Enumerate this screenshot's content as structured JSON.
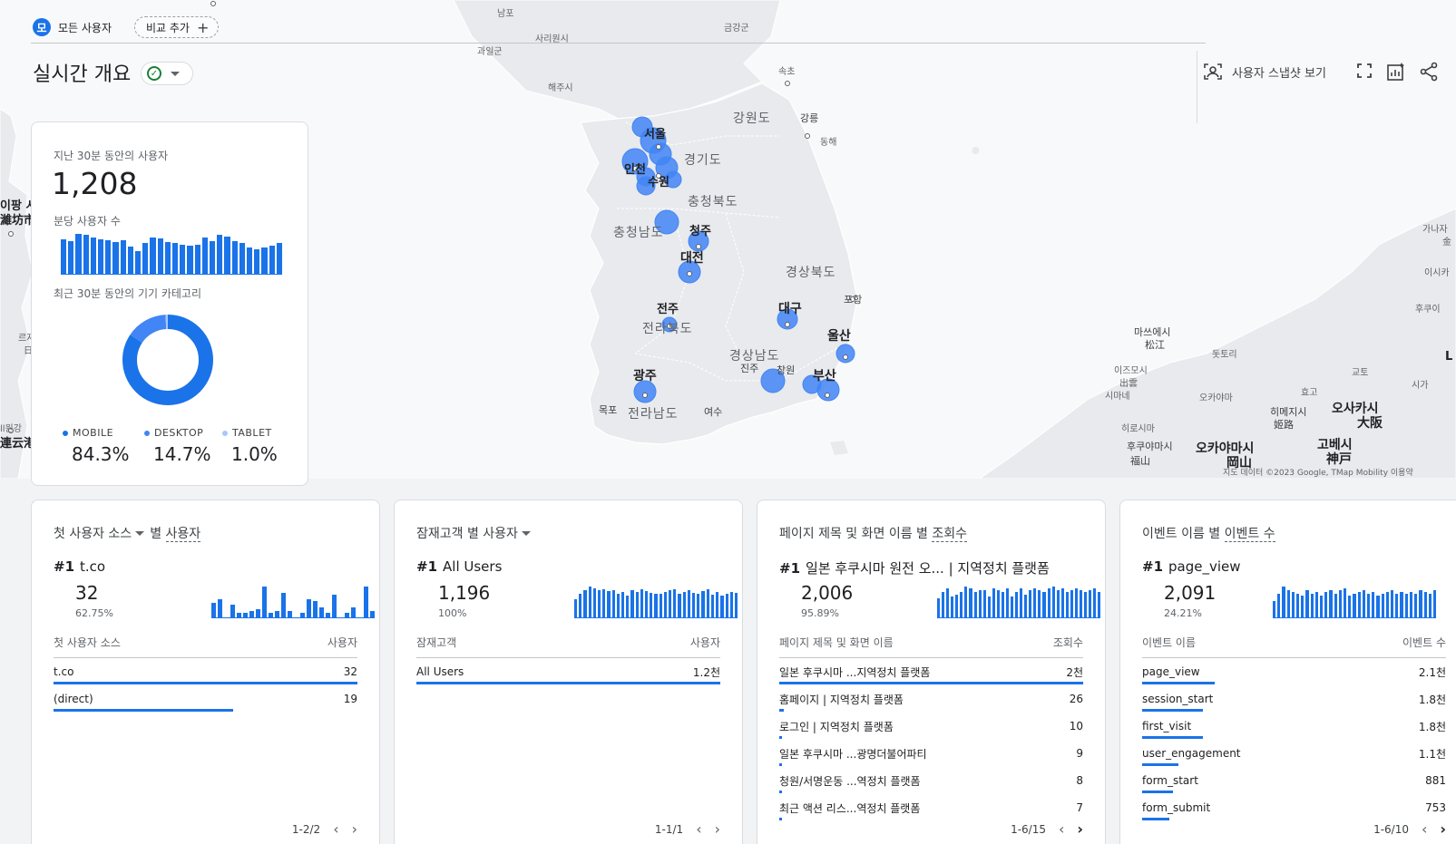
{
  "header": {
    "chip_all_avatar": "모",
    "chip_all_label": "모든 사용자",
    "chip_add_label": "비교 추가",
    "page_title": "실시간 개요",
    "snapshot_label": "사용자 스냅샷 보기"
  },
  "map": {
    "labels": [
      {
        "text": "남포",
        "cls": "tiny"
      },
      {
        "text": "금강군",
        "cls": "tiny"
      },
      {
        "text": "사리원시",
        "cls": "tiny"
      },
      {
        "text": "과일군",
        "cls": "tiny"
      },
      {
        "text": "속초",
        "cls": "tiny"
      },
      {
        "text": "해주시",
        "cls": "tiny"
      },
      {
        "text": "강원도",
        "cls": "prov"
      },
      {
        "text": "강릉",
        "cls": ""
      },
      {
        "text": "동해",
        "cls": "tiny"
      },
      {
        "text": "서울",
        "cls": "city"
      },
      {
        "text": "인천",
        "cls": "city"
      },
      {
        "text": "수원",
        "cls": "city"
      },
      {
        "text": "경기도",
        "cls": "prov"
      },
      {
        "text": "충청북도",
        "cls": "prov"
      },
      {
        "text": "충청남도",
        "cls": "prov"
      },
      {
        "text": "청주",
        "cls": "city"
      },
      {
        "text": "대전",
        "cls": "big"
      },
      {
        "text": "경상북도",
        "cls": "prov"
      },
      {
        "text": "포항",
        "cls": ""
      },
      {
        "text": "대구",
        "cls": "big"
      },
      {
        "text": "전주",
        "cls": "city"
      },
      {
        "text": "전라북도",
        "cls": "prov"
      },
      {
        "text": "울산",
        "cls": "big"
      },
      {
        "text": "경상남도",
        "cls": "prov"
      },
      {
        "text": "진주",
        "cls": ""
      },
      {
        "text": "창원",
        "cls": ""
      },
      {
        "text": "부산",
        "cls": "big"
      },
      {
        "text": "광주",
        "cls": "big"
      },
      {
        "text": "목포",
        "cls": ""
      },
      {
        "text": "전라남도",
        "cls": "prov"
      },
      {
        "text": "여수",
        "cls": ""
      },
      {
        "text": "이팡 시",
        "cls": "city"
      },
      {
        "text": "濰坊市",
        "cls": "city"
      },
      {
        "text": "르자",
        "cls": "tiny"
      },
      {
        "text": "日",
        "cls": "tiny"
      },
      {
        "text": "ll원강",
        "cls": "tiny"
      },
      {
        "text": "連云港",
        "cls": "city"
      },
      {
        "text": "가나자",
        "cls": "tiny"
      },
      {
        "text": "金",
        "cls": "tiny"
      },
      {
        "text": "이시카",
        "cls": "tiny"
      },
      {
        "text": "후쿠이",
        "cls": "tiny"
      },
      {
        "text": "마쓰에시",
        "cls": ""
      },
      {
        "text": "松江",
        "cls": ""
      },
      {
        "text": "돗토리",
        "cls": "tiny"
      },
      {
        "text": "이즈모시",
        "cls": "tiny"
      },
      {
        "text": "出雲",
        "cls": "tiny"
      },
      {
        "text": "시마네",
        "cls": "tiny"
      },
      {
        "text": "교토",
        "cls": "tiny"
      },
      {
        "text": "시가",
        "cls": "tiny"
      },
      {
        "text": "효고",
        "cls": "tiny"
      },
      {
        "text": "오카야마",
        "cls": "tiny"
      },
      {
        "text": "히메지시",
        "cls": ""
      },
      {
        "text": "姬路",
        "cls": ""
      },
      {
        "text": "오사카시",
        "cls": "big"
      },
      {
        "text": "大阪",
        "cls": "big"
      },
      {
        "text": "히로시마",
        "cls": "tiny"
      },
      {
        "text": "후쿠야마시",
        "cls": ""
      },
      {
        "text": "福山",
        "cls": ""
      },
      {
        "text": "오카야마시",
        "cls": "big"
      },
      {
        "text": "岡山",
        "cls": "big"
      },
      {
        "text": "고베시",
        "cls": "big"
      },
      {
        "text": "神戸",
        "cls": "big"
      },
      {
        "text": "L",
        "cls": "city"
      }
    ],
    "attribution": "지도 데이터 ©2023 Google, TMap Mobility  이용약"
  },
  "summary": {
    "users_label": "지난 30분 동안의 사용자",
    "users_value": "1,208",
    "per_minute_label": "분당 사용자 수",
    "per_minute": [
      36,
      34,
      42,
      41,
      38,
      36,
      35,
      33,
      35,
      29,
      24,
      32,
      38,
      37,
      33,
      32,
      31,
      30,
      31,
      38,
      34,
      41,
      39,
      34,
      32,
      28,
      26,
      28,
      30,
      32
    ],
    "device_label": "최근 30분 동안의 기기 카테고리",
    "devices": [
      {
        "name": "MOBILE",
        "value": "84.3%",
        "share": 84.3,
        "color": "#1a73e8"
      },
      {
        "name": "DESKTOP",
        "value": "14.7%",
        "share": 14.7,
        "color": "#4285f4"
      },
      {
        "name": "TABLET",
        "value": "1.0%",
        "share": 1.0,
        "color": "#a8c7fa"
      }
    ]
  },
  "cards": [
    {
      "title_pre": "첫 사용자 소스",
      "title_by": "별",
      "title_metric": "사용자",
      "has_dropdown": true,
      "top_rank": "#1",
      "top_name": "t.co",
      "top_value": "32",
      "top_pct": "62.75%",
      "spark": [
        14,
        18,
        0,
        12,
        4,
        4,
        6,
        8,
        30,
        4,
        6,
        24,
        6,
        0,
        4,
        18,
        16,
        10,
        4,
        22,
        0,
        4,
        10,
        0,
        30,
        6
      ],
      "col_left": "첫 사용자 소스",
      "col_right": "사용자",
      "rows": [
        {
          "label": "t.co",
          "value": "32",
          "share": 100
        },
        {
          "label": "(direct)",
          "value": "19",
          "share": 59
        }
      ],
      "pager": "1-2/2",
      "next_active": false
    },
    {
      "title_pre": "잠재고객 별 사용자",
      "title_by": "",
      "title_metric": "",
      "has_dropdown": true,
      "top_rank": "#1",
      "top_name": "All Users",
      "top_value": "1,196",
      "top_pct": "100%",
      "spark": [
        20,
        26,
        30,
        34,
        32,
        30,
        31,
        29,
        30,
        26,
        28,
        24,
        30,
        28,
        31,
        29,
        27,
        26,
        26,
        28,
        30,
        31,
        26,
        28,
        30,
        27,
        26,
        29,
        31,
        25,
        28,
        24,
        26,
        28,
        27
      ],
      "col_left": "잠재고객",
      "col_right": "사용자",
      "rows": [
        {
          "label": "All Users",
          "value": "1.2천",
          "share": 100
        }
      ],
      "pager": "1-1/1",
      "next_active": false
    },
    {
      "title_pre": "페이지 제목 및 화면 이름 별",
      "title_by": "",
      "title_metric": "조회수",
      "has_dropdown": false,
      "top_rank": "#1",
      "top_name": "일본 후쿠시마 원전 오... | 지역정치 플랫폼",
      "top_value": "2,006",
      "top_pct": "95.89%",
      "spark": [
        20,
        26,
        30,
        22,
        24,
        26,
        32,
        30,
        26,
        28,
        28,
        22,
        30,
        28,
        26,
        30,
        22,
        26,
        30,
        24,
        28,
        30,
        28,
        26,
        30,
        32,
        28,
        30,
        26,
        28,
        30,
        28,
        26,
        28,
        30,
        26
      ],
      "col_left": "페이지 제목 및 화면 이름",
      "col_right": "조회수",
      "rows": [
        {
          "label": "일본 후쿠시마 ...지역정치 플랫폼",
          "value": "2천",
          "share": 100
        },
        {
          "label": "홈페이지 | 지역정치 플랫폼",
          "value": "26",
          "share": 1.5
        },
        {
          "label": "로그인 | 지역정치 플랫폼",
          "value": "10",
          "share": 1
        },
        {
          "label": "일본 후쿠시마 ...광명더불어파티",
          "value": "9",
          "share": 1
        },
        {
          "label": "청원/서명운동 ...역정치 플랫폼",
          "value": "8",
          "share": 1
        },
        {
          "label": "최근 액션 리스...역정치 플랫폼",
          "value": "7",
          "share": 1
        }
      ],
      "pager": "1-6/15",
      "next_active": true
    },
    {
      "title_pre": "이벤트 이름 별",
      "title_by": "",
      "title_metric": "이벤트 수",
      "has_dropdown": false,
      "top_rank": "#1",
      "top_name": "page_view",
      "top_value": "2,091",
      "top_pct": "24.21%",
      "spark": [
        18,
        26,
        34,
        30,
        28,
        26,
        24,
        30,
        26,
        28,
        24,
        28,
        30,
        26,
        30,
        32,
        24,
        26,
        28,
        30,
        26,
        28,
        24,
        26,
        28,
        30,
        26,
        28,
        26,
        28,
        26,
        30,
        28,
        26,
        30
      ],
      "col_left": "이벤트 이름",
      "col_right": "이벤트 수",
      "rows": [
        {
          "label": "page_view",
          "value": "2.1천",
          "share": 24
        },
        {
          "label": "session_start",
          "value": "1.8천",
          "share": 20
        },
        {
          "label": "first_visit",
          "value": "1.8천",
          "share": 20
        },
        {
          "label": "user_engagement",
          "value": "1.1천",
          "share": 12
        },
        {
          "label": "form_start",
          "value": "881",
          "share": 10
        },
        {
          "label": "form_submit",
          "value": "753",
          "share": 9
        }
      ],
      "pager": "1-6/10",
      "next_active": true
    }
  ]
}
